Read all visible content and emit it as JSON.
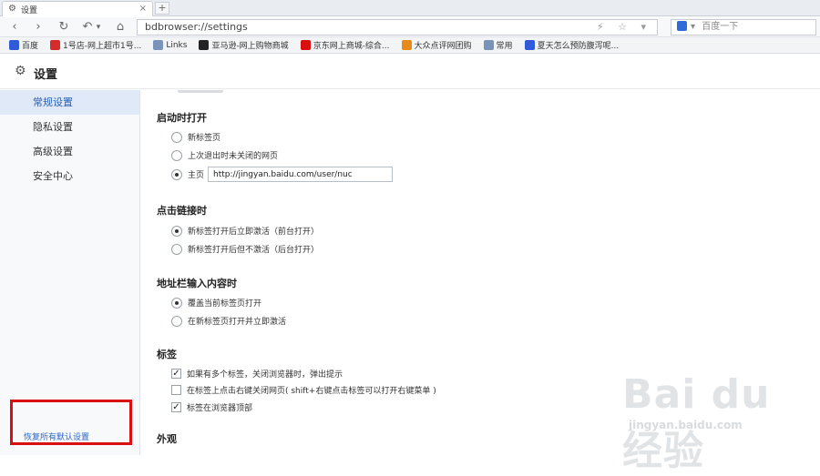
{
  "tab": {
    "title": "设置",
    "close": "×",
    "new_tab": "+"
  },
  "nav": {
    "back": "‹",
    "forward": "›",
    "reload": "↻",
    "undo": "↶",
    "undo_menu": "▾",
    "home": "⌂"
  },
  "address": {
    "value": "bdbrowser://settings",
    "icons": "⚡ ☆ ▾"
  },
  "search": {
    "placeholder": "百度一下",
    "engine_menu": "▾"
  },
  "bookmarks": [
    {
      "label": "百度",
      "icon": "paw-icon",
      "color": "#2f5bd8"
    },
    {
      "label": "1号店-网上超市1号...",
      "icon": "shop-icon",
      "color": "#d62b2b"
    },
    {
      "label": "Links",
      "icon": "folder-icon",
      "color": "#7a93b8"
    },
    {
      "label": "亚马逊-网上购物商城",
      "icon": "amazon-icon",
      "color": "#222222"
    },
    {
      "label": "京东网上商城-综合...",
      "icon": "jd-icon",
      "color": "#d81010"
    },
    {
      "label": "大众点评网团购",
      "icon": "star-icon",
      "color": "#e88a1a"
    },
    {
      "label": "常用",
      "icon": "folder-icon",
      "color": "#7a93b8"
    },
    {
      "label": "夏天怎么预防腹泻呢...",
      "icon": "paw-icon",
      "color": "#2f5bd8"
    }
  ],
  "settings": {
    "title": "设置"
  },
  "sidebar": {
    "items": [
      {
        "label": "常规设置",
        "active": true
      },
      {
        "label": "隐私设置",
        "active": false
      },
      {
        "label": "高级设置",
        "active": false
      },
      {
        "label": "安全中心",
        "active": false
      }
    ],
    "restore": "恢复所有默认设置"
  },
  "startup": {
    "title": "启动时打开",
    "options": [
      "新标签页",
      "上次退出时未关闭的网页",
      "主页"
    ],
    "homepage": "http://jingyan.baidu.com/user/nuc"
  },
  "link_click": {
    "title": "点击链接时",
    "options": [
      "新标签打开后立即激活（前台打开）",
      "新标签打开后但不激活（后台打开）"
    ]
  },
  "address_input": {
    "title": "地址栏输入内容时",
    "options": [
      "覆盖当前标签页打开",
      "在新标签页打开并立即激活"
    ]
  },
  "tabs_section": {
    "title": "标签",
    "options": [
      "如果有多个标签，关闭浏览器时，弹出提示",
      "在标签上点击右键关闭网页( shift+右键点击标签可以打开右键菜单 )",
      "标签在浏览器顶部"
    ],
    "checked": [
      true,
      false,
      true
    ]
  },
  "appearance": {
    "title": "外观"
  },
  "watermark": {
    "logo": "Bai du 经验",
    "url": "jingyan.baidu.com"
  }
}
